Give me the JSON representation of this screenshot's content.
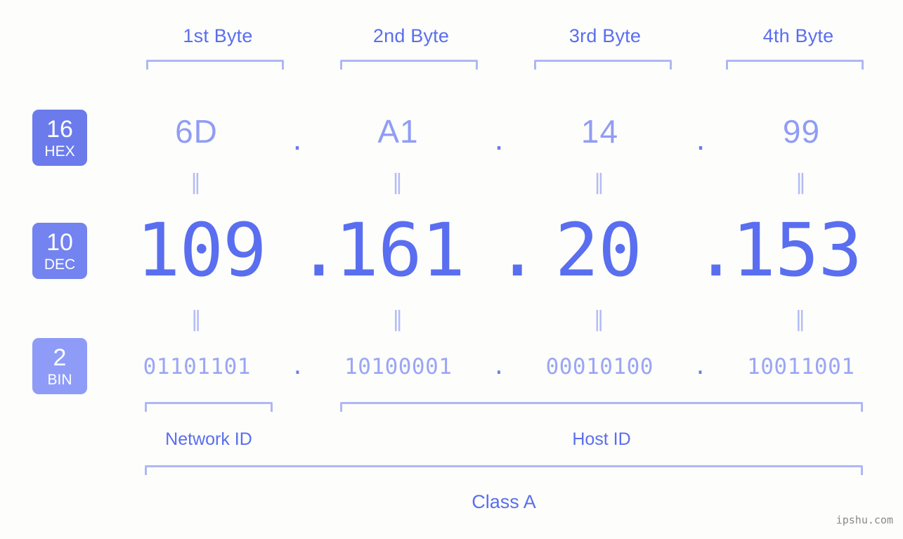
{
  "diagram": {
    "title": "IP address byte breakdown",
    "ip_address": "109.161.20.153",
    "accent_color": "#5a6ef0",
    "bracket_color": "#aeb7f5",
    "background_color": "#fdfdfb"
  },
  "byte_headers": [
    {
      "label": "1st Byte"
    },
    {
      "label": "2nd Byte"
    },
    {
      "label": "3rd Byte"
    },
    {
      "label": "4th Byte"
    }
  ],
  "bases": [
    {
      "number": "16",
      "name": "HEX",
      "color": "#6b7bec"
    },
    {
      "number": "10",
      "name": "DEC",
      "color": "#7383ef"
    },
    {
      "number": "2",
      "name": "BIN",
      "color": "#8e9cf7"
    }
  ],
  "separator": ".",
  "equals_glyph": "‖",
  "rows": {
    "hex": {
      "values": [
        "6D",
        "A1",
        "14",
        "99"
      ]
    },
    "dec": {
      "values": [
        "109",
        "161",
        "20",
        "153"
      ]
    },
    "bin": {
      "values": [
        "01101101",
        "10100001",
        "00010100",
        "10011001"
      ]
    }
  },
  "sections": {
    "network_id": {
      "label": "Network ID"
    },
    "host_id": {
      "label": "Host ID"
    },
    "class": {
      "label": "Class A"
    }
  },
  "watermark": {
    "text": "ipshu.com"
  }
}
